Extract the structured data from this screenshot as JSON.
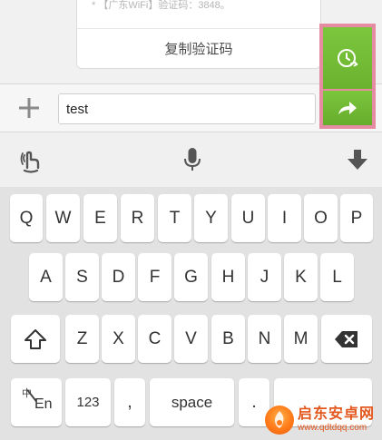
{
  "chat": {
    "message_snippet": "* 【广东WiFi】验证码：3848。",
    "copy_button_label": "复制验证码"
  },
  "input_bar": {
    "text_value": "test"
  },
  "keyboard": {
    "row1": [
      "Q",
      "W",
      "E",
      "R",
      "T",
      "Y",
      "U",
      "I",
      "O",
      "P"
    ],
    "row2": [
      "A",
      "S",
      "D",
      "F",
      "G",
      "H",
      "J",
      "K",
      "L"
    ],
    "row3_letters": [
      "Z",
      "X",
      "C",
      "V",
      "B",
      "N",
      "M"
    ],
    "lang_key_top": "中",
    "lang_key_bottom": "En",
    "numbers_key": "123",
    "comma_key": ",",
    "space_key": "space",
    "period_key": "."
  },
  "watermark": {
    "title": "启东安卓网",
    "url": "www.qdtdqq.com"
  },
  "colors": {
    "accent_green": "#6bb32f",
    "highlight_pink": "#e58ca2",
    "watermark_orange": "#e2571d"
  }
}
